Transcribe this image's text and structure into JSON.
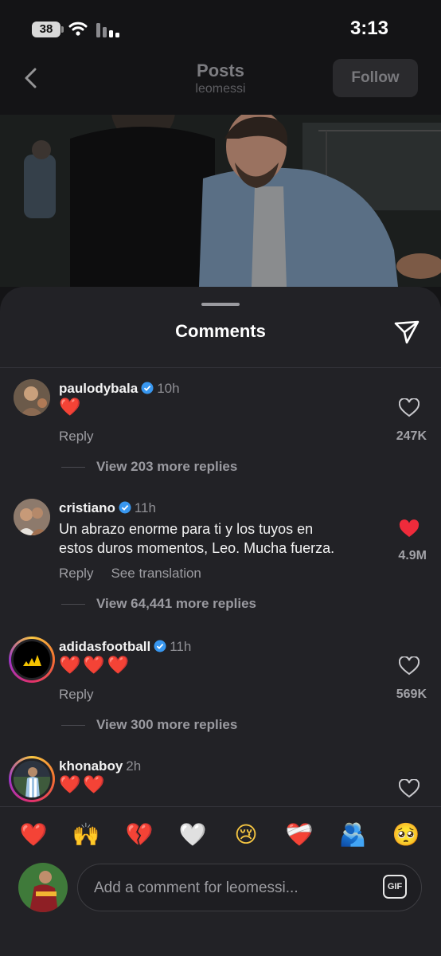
{
  "status_bar": {
    "battery": "38",
    "time": "3:13"
  },
  "header": {
    "title": "Posts",
    "username": "leomessi",
    "follow_label": "Follow"
  },
  "sheet": {
    "title": "Comments"
  },
  "comments": [
    {
      "username": "paulodybala",
      "verified": true,
      "time": "10h",
      "text": "❤️",
      "reply_label": "Reply",
      "likes": "247K",
      "liked": false,
      "view_replies": "View 203 more replies"
    },
    {
      "username": "cristiano",
      "verified": true,
      "time": "11h",
      "text_line1": "Un abrazo enorme para ti y los tuyos en",
      "text_line2": "estos duros momentos, Leo. Mucha fuerza.",
      "reply_label": "Reply",
      "see_translation": "See translation",
      "likes": "4.9M",
      "liked": true,
      "view_replies": "View 64,441 more replies"
    },
    {
      "username": "adidasfootball",
      "verified": true,
      "time": "11h",
      "text": "❤️❤️❤️",
      "reply_label": "Reply",
      "likes": "569K",
      "liked": false,
      "view_replies": "View 300 more replies"
    },
    {
      "username": "khonaboy",
      "verified": false,
      "time": "2h",
      "text": "❤️❤️",
      "liked": false
    }
  ],
  "emoji_bar": [
    "❤️",
    "🙌",
    "💔",
    "🤍",
    "😢",
    "❤️‍🩹",
    "🫂",
    "🥺"
  ],
  "composer": {
    "placeholder": "Add a comment for leomessi...",
    "gif_label": "GIF"
  },
  "colors": {
    "sheet_bg": "#222226",
    "like_red": "#ef2b3b",
    "verified_blue": "#3897f0"
  }
}
